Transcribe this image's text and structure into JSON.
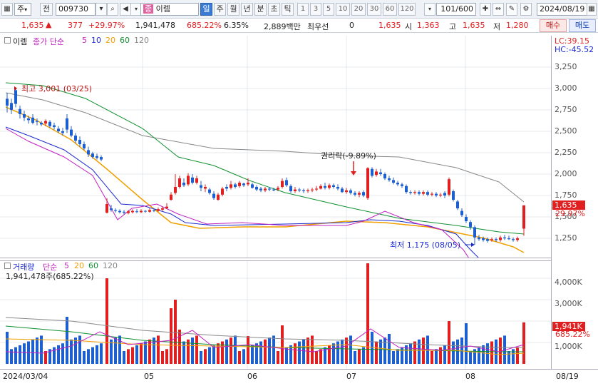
{
  "toolbar": {
    "market_type": "주",
    "prev_label": "전",
    "code": "009730",
    "name_badge": "종",
    "stock_name": "이렘",
    "periods": [
      "일",
      "주",
      "월",
      "년",
      "분",
      "초",
      "틱"
    ],
    "selected_period": "일",
    "numbers": [
      "1",
      "3",
      "5",
      "10",
      "20",
      "30",
      "60",
      "120"
    ],
    "page_count": "101/600",
    "date": "2024/08/19"
  },
  "quote": {
    "price": "1,635",
    "change": "377",
    "change_pct": "+29.97%",
    "volume": "1,941,478",
    "vol_ratio": "685.22%",
    "turnover": "6.35%",
    "amount": "2,889백만",
    "priority_label": "최우선",
    "priority_value": "0",
    "last": "1,635",
    "open_label": "시",
    "open": "1,363",
    "high_label": "고",
    "high": "1,635",
    "low_label": "저",
    "low": "1,280",
    "buy_label": "매수",
    "sell_label": "매도"
  },
  "price_legend": {
    "name": "이렘",
    "series": "종가 단순",
    "ma5": "5",
    "ma10": "10",
    "ma20": "20",
    "ma60": "60",
    "ma120": "120",
    "lc": "LC:39.15",
    "hc": "HC:-45.52"
  },
  "annotations": {
    "high": "최고 3,001 (03/25)",
    "low": "최저 1,175 (08/05)",
    "rights": "권리락(-9.89%)"
  },
  "vol_legend": {
    "name": "거래량",
    "series": "단순",
    "ma5": "5",
    "ma20": "20",
    "ma60": "60",
    "ma120": "120",
    "current": "1,941,478주(685.22%)"
  },
  "price_axis": [
    "3,250",
    "3,000",
    "2,750",
    "2,500",
    "2,250",
    "2,000",
    "1,750",
    "1,500",
    "1,250"
  ],
  "price_tag": {
    "price": "1,635",
    "pct": "29.97%"
  },
  "vol_axis": [
    "4,000K",
    "3,000K",
    "2,000K",
    "1,000K"
  ],
  "vol_tag": {
    "value": "1,941K",
    "pct": "685.22%"
  },
  "date_axis": [
    "2024/03/04",
    "05",
    "06",
    "07",
    "08"
  ],
  "date_right": "08/19",
  "colors": {
    "up": "#e02020",
    "down": "#1e5fd0",
    "ma5": "#c020c0",
    "ma10": "#1c2bd0",
    "ma20": "#f0a000",
    "ma60": "#109030",
    "ma120": "#888888"
  }
}
